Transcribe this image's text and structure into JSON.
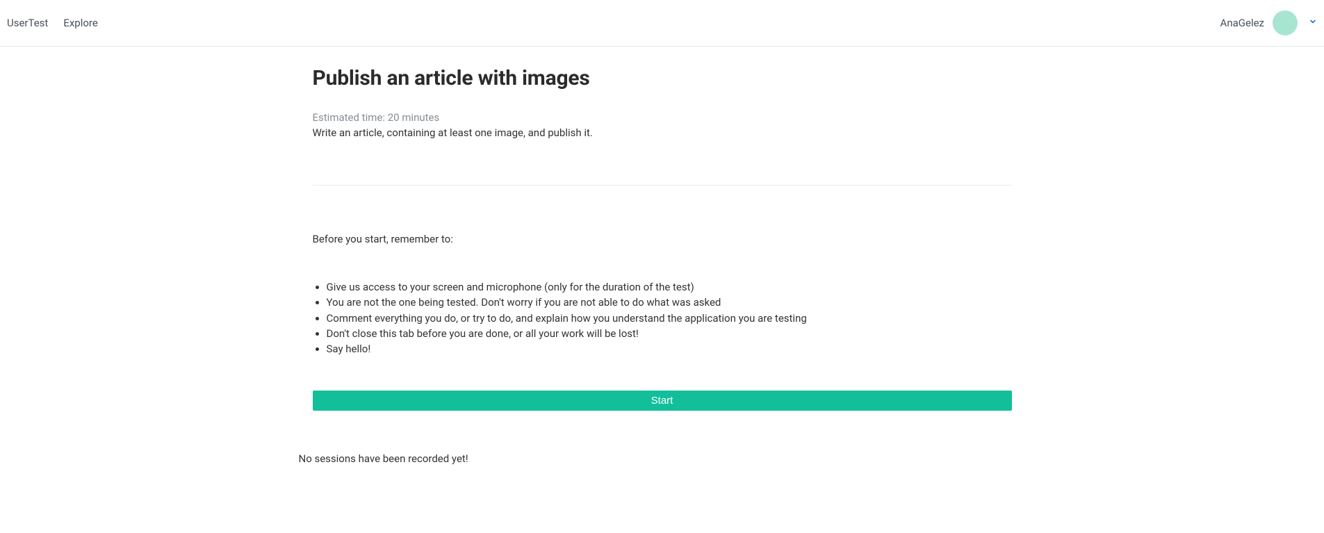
{
  "header": {
    "brand": "UserTest",
    "explore": "Explore",
    "username": "AnaGelez"
  },
  "colors": {
    "accent": "#13bf9a",
    "avatar": "#a7e5d1"
  },
  "main": {
    "title": "Publish an article with images",
    "estimated_time": "Estimated time: 20 minutes",
    "instruction": "Write an article, containing at least one image, and publish it.",
    "before_start": "Before you start, remember to:",
    "reminders": [
      "Give us access to your screen and microphone (only for the duration of the test)",
      "You are not the one being tested. Don't worry if you are not able to do what was asked",
      "Comment everything you do, or try to do, and explain how you understand the application you are testing",
      "Don't close this tab before you are done, or all your work will be lost!",
      "Say hello!"
    ],
    "start_label": "Start",
    "no_sessions": "No sessions have been recorded yet!"
  }
}
